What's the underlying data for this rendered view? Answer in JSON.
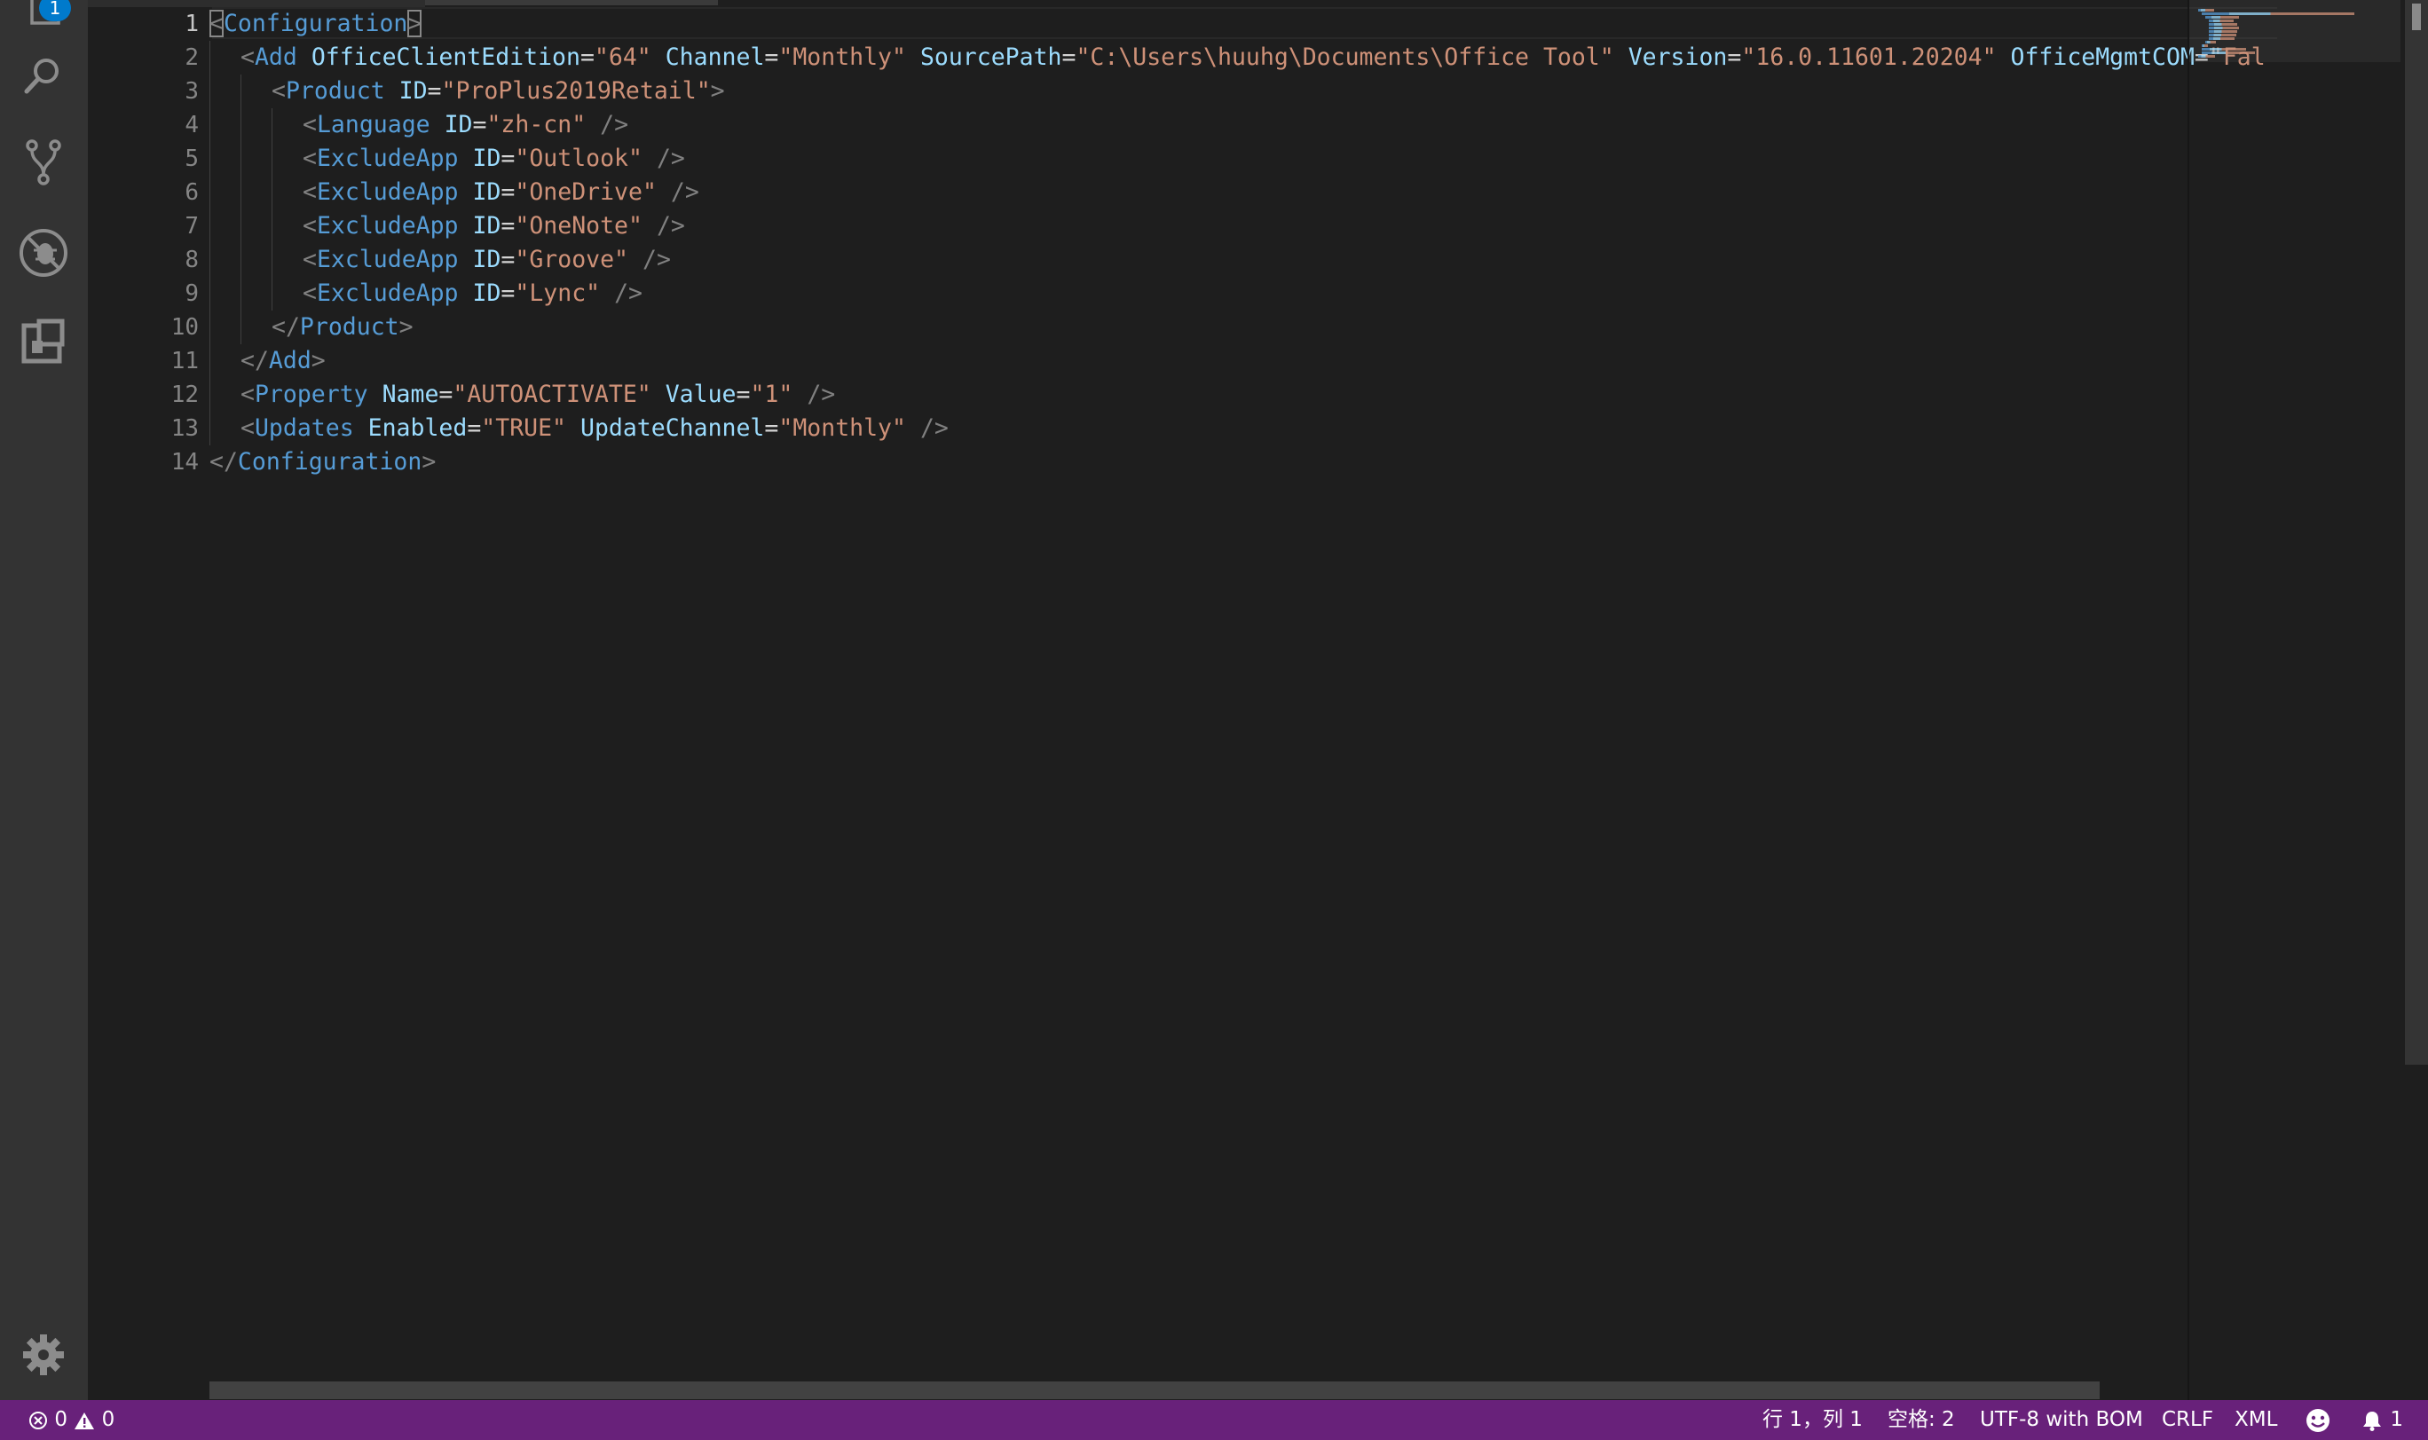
{
  "activity_bar": {
    "explorer_badge": "1",
    "icons": [
      "files-icon",
      "search-icon",
      "source-control-icon",
      "debug-icon",
      "extensions-icon",
      "settings-gear-icon"
    ]
  },
  "editor": {
    "active_line": 1,
    "lines": [
      {
        "n": "1",
        "indent": 0,
        "tokens": [
          [
            "t",
            "<"
          ],
          [
            "tg",
            "Configuration"
          ],
          [
            "t",
            ">"
          ]
        ]
      },
      {
        "n": "2",
        "indent": 1,
        "tokens": [
          [
            "t",
            "<"
          ],
          [
            "tg",
            "Add"
          ],
          [
            "sp",
            " "
          ],
          [
            "at",
            "OfficeClientEdition"
          ],
          [
            "eq",
            "="
          ],
          [
            "st",
            "\"64\""
          ],
          [
            "sp",
            " "
          ],
          [
            "at",
            "Channel"
          ],
          [
            "eq",
            "="
          ],
          [
            "st",
            "\"Monthly\""
          ],
          [
            "sp",
            " "
          ],
          [
            "at",
            "SourcePath"
          ],
          [
            "eq",
            "="
          ],
          [
            "st",
            "\"C:\\Users\\huuhg\\Documents\\Office Tool\""
          ],
          [
            "sp",
            " "
          ],
          [
            "at",
            "Version"
          ],
          [
            "eq",
            "="
          ],
          [
            "st",
            "\"16.0.11601.20204\""
          ],
          [
            "sp",
            " "
          ],
          [
            "at",
            "OfficeMgmtCOM"
          ],
          [
            "eq",
            "="
          ],
          [
            "st",
            "\"Fal"
          ]
        ]
      },
      {
        "n": "3",
        "indent": 2,
        "tokens": [
          [
            "t",
            "<"
          ],
          [
            "tg",
            "Product"
          ],
          [
            "sp",
            " "
          ],
          [
            "at",
            "ID"
          ],
          [
            "eq",
            "="
          ],
          [
            "st",
            "\"ProPlus2019Retail\""
          ],
          [
            "t",
            ">"
          ]
        ]
      },
      {
        "n": "4",
        "indent": 3,
        "tokens": [
          [
            "t",
            "<"
          ],
          [
            "tg",
            "Language"
          ],
          [
            "sp",
            " "
          ],
          [
            "at",
            "ID"
          ],
          [
            "eq",
            "="
          ],
          [
            "st",
            "\"zh-cn\""
          ],
          [
            "sp",
            " "
          ],
          [
            "t",
            "/>"
          ]
        ]
      },
      {
        "n": "5",
        "indent": 3,
        "tokens": [
          [
            "t",
            "<"
          ],
          [
            "tg",
            "ExcludeApp"
          ],
          [
            "sp",
            " "
          ],
          [
            "at",
            "ID"
          ],
          [
            "eq",
            "="
          ],
          [
            "st",
            "\"Outlook\""
          ],
          [
            "sp",
            " "
          ],
          [
            "t",
            "/>"
          ]
        ]
      },
      {
        "n": "6",
        "indent": 3,
        "tokens": [
          [
            "t",
            "<"
          ],
          [
            "tg",
            "ExcludeApp"
          ],
          [
            "sp",
            " "
          ],
          [
            "at",
            "ID"
          ],
          [
            "eq",
            "="
          ],
          [
            "st",
            "\"OneDrive\""
          ],
          [
            "sp",
            " "
          ],
          [
            "t",
            "/>"
          ]
        ]
      },
      {
        "n": "7",
        "indent": 3,
        "tokens": [
          [
            "t",
            "<"
          ],
          [
            "tg",
            "ExcludeApp"
          ],
          [
            "sp",
            " "
          ],
          [
            "at",
            "ID"
          ],
          [
            "eq",
            "="
          ],
          [
            "st",
            "\"OneNote\""
          ],
          [
            "sp",
            " "
          ],
          [
            "t",
            "/>"
          ]
        ]
      },
      {
        "n": "8",
        "indent": 3,
        "tokens": [
          [
            "t",
            "<"
          ],
          [
            "tg",
            "ExcludeApp"
          ],
          [
            "sp",
            " "
          ],
          [
            "at",
            "ID"
          ],
          [
            "eq",
            "="
          ],
          [
            "st",
            "\"Groove\""
          ],
          [
            "sp",
            " "
          ],
          [
            "t",
            "/>"
          ]
        ]
      },
      {
        "n": "9",
        "indent": 3,
        "tokens": [
          [
            "t",
            "<"
          ],
          [
            "tg",
            "ExcludeApp"
          ],
          [
            "sp",
            " "
          ],
          [
            "at",
            "ID"
          ],
          [
            "eq",
            "="
          ],
          [
            "st",
            "\"Lync\""
          ],
          [
            "sp",
            " "
          ],
          [
            "t",
            "/>"
          ]
        ]
      },
      {
        "n": "10",
        "indent": 2,
        "tokens": [
          [
            "t",
            "</"
          ],
          [
            "tg",
            "Product"
          ],
          [
            "t",
            ">"
          ]
        ]
      },
      {
        "n": "11",
        "indent": 1,
        "tokens": [
          [
            "t",
            "</"
          ],
          [
            "tg",
            "Add"
          ],
          [
            "t",
            ">"
          ]
        ]
      },
      {
        "n": "12",
        "indent": 1,
        "tokens": [
          [
            "t",
            "<"
          ],
          [
            "tg",
            "Property"
          ],
          [
            "sp",
            " "
          ],
          [
            "at",
            "Name"
          ],
          [
            "eq",
            "="
          ],
          [
            "st",
            "\"AUTOACTIVATE\""
          ],
          [
            "sp",
            " "
          ],
          [
            "at",
            "Value"
          ],
          [
            "eq",
            "="
          ],
          [
            "st",
            "\"1\""
          ],
          [
            "sp",
            " "
          ],
          [
            "t",
            "/>"
          ]
        ]
      },
      {
        "n": "13",
        "indent": 1,
        "tokens": [
          [
            "t",
            "<"
          ],
          [
            "tg",
            "Updates"
          ],
          [
            "sp",
            " "
          ],
          [
            "at",
            "Enabled"
          ],
          [
            "eq",
            "="
          ],
          [
            "st",
            "\"TRUE\""
          ],
          [
            "sp",
            " "
          ],
          [
            "at",
            "UpdateChannel"
          ],
          [
            "eq",
            "="
          ],
          [
            "st",
            "\"Monthly\""
          ],
          [
            "sp",
            " "
          ],
          [
            "t",
            "/>"
          ]
        ]
      },
      {
        "n": "14",
        "indent": 0,
        "tokens": [
          [
            "t",
            "</"
          ],
          [
            "tg",
            "Configuration"
          ],
          [
            "t",
            ">"
          ]
        ]
      }
    ]
  },
  "status_bar": {
    "errors": "0",
    "warnings": "0",
    "cursor": "行 1，列 1",
    "indent": "空格: 2",
    "encoding": "UTF-8 with BOM",
    "eol": "CRLF",
    "language": "XML",
    "notifications": "1"
  },
  "colors": {
    "status_bar": "#68217a",
    "badge": "#007acc",
    "tag": "#569cd6",
    "attribute": "#9cdcfe",
    "string": "#ce9178"
  }
}
